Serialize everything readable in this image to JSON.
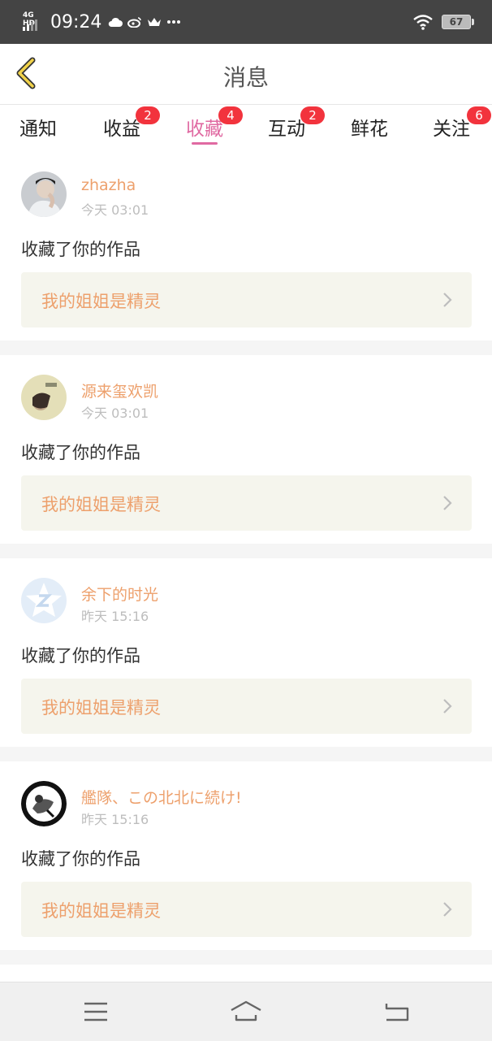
{
  "status_bar": {
    "network": "4G HD",
    "time": "09:24",
    "battery": "67"
  },
  "header": {
    "title": "消息"
  },
  "tabs": [
    {
      "label": "通知",
      "badge": ""
    },
    {
      "label": "收益",
      "badge": "2"
    },
    {
      "label": "收藏",
      "badge": "4",
      "active": true
    },
    {
      "label": "互动",
      "badge": "2"
    },
    {
      "label": "鲜花",
      "badge": ""
    },
    {
      "label": "关注",
      "badge": "6"
    }
  ],
  "messages": [
    {
      "username": "zhazha",
      "time": "今天 03:01",
      "action": "收藏了你的作品",
      "work": "我的姐姐是精灵"
    },
    {
      "username": "源来玺欢凯",
      "time": "今天 03:01",
      "action": "收藏了你的作品",
      "work": "我的姐姐是精灵"
    },
    {
      "username": "余下的时光",
      "time": "昨天 15:16",
      "action": "收藏了你的作品",
      "work": "我的姐姐是精灵"
    },
    {
      "username": "艦隊、この北北に続け!",
      "time": "昨天 15:16",
      "action": "收藏了你的作品",
      "work": "我的姐姐是精灵"
    }
  ],
  "colors": {
    "accent": "#e06aa2",
    "username": "#eda06c",
    "badge": "#f2333d",
    "status_bar": "#444444"
  }
}
